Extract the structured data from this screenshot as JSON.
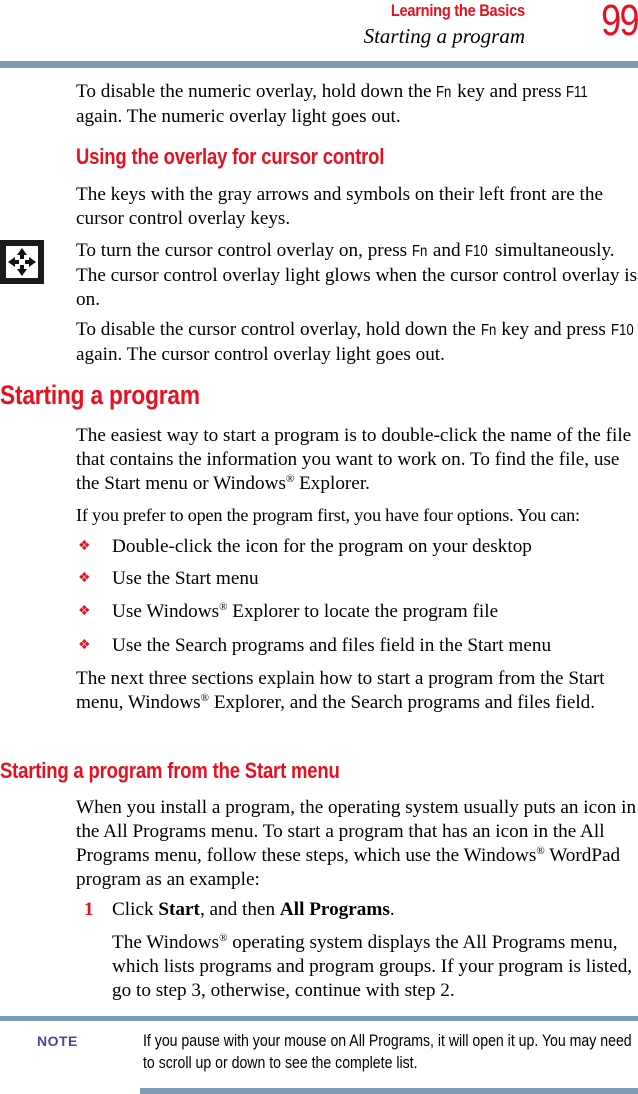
{
  "header": {
    "chapter": "Learning the Basics",
    "section": "Starting a program",
    "page_number": "99"
  },
  "colors": {
    "accent_red": "#e8101e",
    "rule_blue": "#7f9ab5",
    "note_purple": "#5a3d99"
  },
  "numeric_overlay": {
    "p1_a": "To disable the numeric overlay, hold down the ",
    "p1_key1": "Fn",
    "p1_b": " key and press ",
    "p1_key2": "F11",
    "p1_c": " again. The numeric overlay light goes out."
  },
  "cursor_section": {
    "heading": "Using the overlay for cursor control",
    "intro": "The keys with the gray arrows and symbols on their left front are the cursor control overlay keys.",
    "icon": "cursor-arrows-icon",
    "p_on_a": "To turn the cursor control overlay on, press ",
    "p_on_key1": "Fn",
    "p_on_b": " and ",
    "p_on_key2": "F10",
    "p_on_c": " simultaneously. The cursor control overlay light glows when the cursor control overlay is on.",
    "p_off_a": "To disable the cursor control overlay, hold down the ",
    "p_off_key1": "Fn",
    "p_off_b": " key and press ",
    "p_off_key2": "F10",
    "p_off_c": " again. The cursor control overlay light goes out."
  },
  "starting_section": {
    "heading": "Starting a program",
    "p1_a": "The easiest way to start a program is to double-click the name of the file that contains the information you want to work on. To find the file, use the Start menu or Windows",
    "reg": "®",
    "p1_b": " Explorer.",
    "p2": "If you prefer to open the program first, you have four options. You can:",
    "bullet_glyph": "❖",
    "bullets": [
      {
        "a": "Double-click the icon for the program on your desktop",
        "b": ""
      },
      {
        "a": "Use the Start menu",
        "b": ""
      },
      {
        "a": "Use Windows",
        "b": " Explorer to locate the program file"
      },
      {
        "a": "Use the Search programs and files field in the Start menu",
        "b": ""
      }
    ],
    "p3_a": "The next three sections explain how to start a program from the Start menu, Windows",
    "p3_b": " Explorer, and the Search programs and files field."
  },
  "start_menu_section": {
    "heading": "Starting a program from the Start menu",
    "p1_a": "When you install a program, the operating system usually puts an icon in the All Programs menu. To start a program that has an icon in the All Programs menu, follow these steps, which use the Windows",
    "p1_b": " WordPad program as an example:",
    "steps": [
      {
        "number": "1",
        "pre": "Click ",
        "bold1": "Start",
        "mid": ", and then ",
        "bold2": "All Programs",
        "post": ".",
        "sub_a": "The Windows",
        "sub_b": " operating system displays the All Programs menu, which lists programs and program groups. If your program is listed, go to step 3, otherwise, continue with step 2."
      }
    ]
  },
  "note": {
    "label": "NOTE",
    "text": "If you pause with your mouse on All Programs, it will open it up. You may need to scroll up or down to see the complete list."
  }
}
